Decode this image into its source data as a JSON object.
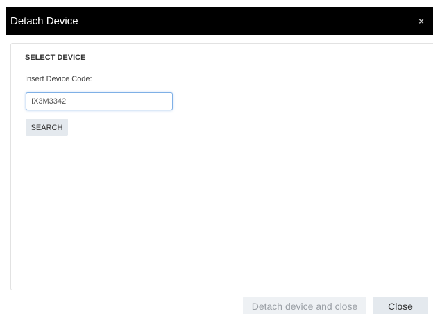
{
  "dialog": {
    "title": "Detach Device",
    "close_glyph": "×",
    "close_icon": "close-icon"
  },
  "form": {
    "section_title": "SELECT DEVICE",
    "code_label": "Insert Device Code:",
    "code_value": "IX3M3342",
    "search_label": "SEARCH"
  },
  "footer": {
    "detach_label": "Detach device and close",
    "detach_enabled": false,
    "close_label": "Close"
  },
  "colors": {
    "titlebar": "#000000",
    "input_focus_border": "#7fb0e6",
    "button_bg": "#e4e9ee",
    "disabled_text": "#9a9fa5"
  }
}
